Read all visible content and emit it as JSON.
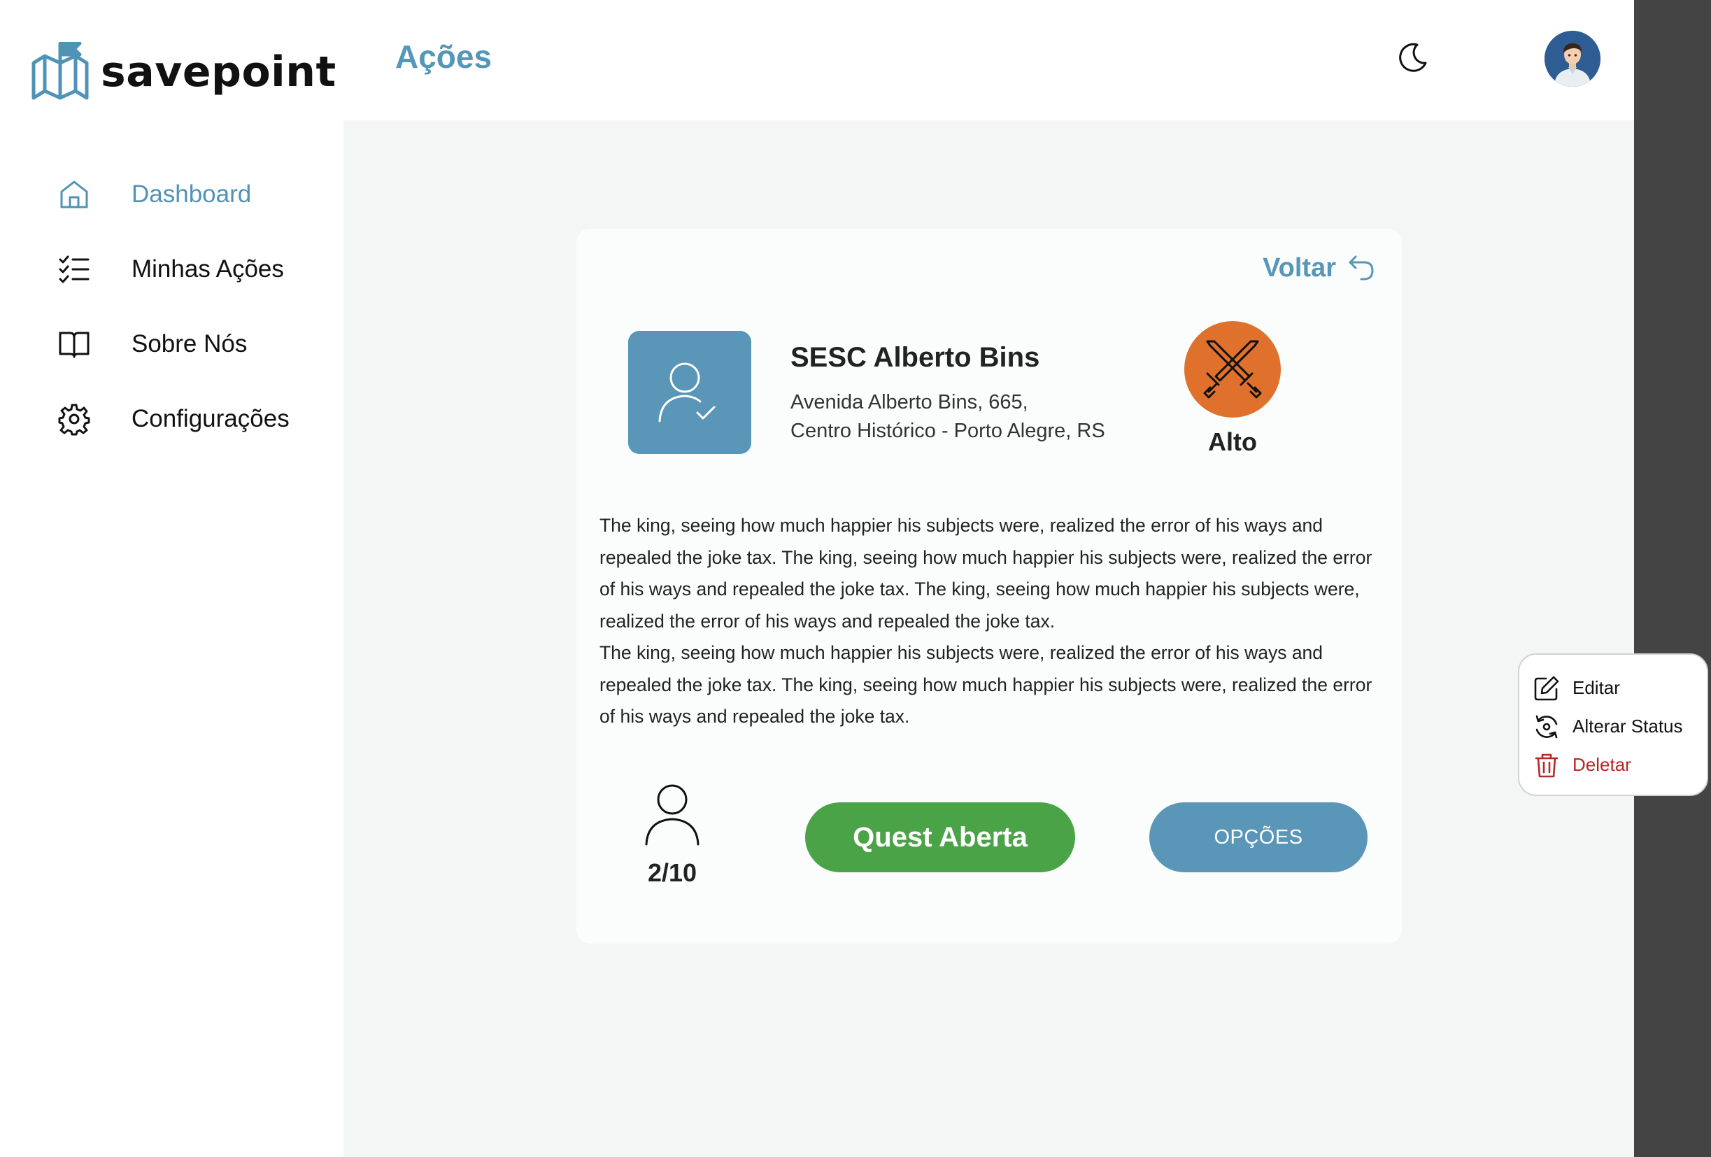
{
  "app": {
    "logo_text": "savepoint",
    "colors": {
      "accent": "#5497b9",
      "success": "#4aa346",
      "level": "#e0712c",
      "danger": "#b52828"
    }
  },
  "sidebar": {
    "items": [
      {
        "label": "Dashboard",
        "icon": "home-icon",
        "active": true
      },
      {
        "label": "Minhas Ações",
        "icon": "checklist-icon"
      },
      {
        "label": "Sobre Nós",
        "icon": "book-icon"
      },
      {
        "label": "Configurações",
        "icon": "gear-icon"
      }
    ]
  },
  "header": {
    "title": "Ações",
    "theme_icon": "moon-icon",
    "avatar_icon": "user-avatar"
  },
  "card": {
    "back_label": "Voltar",
    "org_name": "SESC Alberto Bins",
    "address_line1": "Avenida Alberto Bins, 665,",
    "address_line2": "Centro Histórico - Porto Alegre, RS",
    "level_label": "Alto",
    "description": [
      "The king, seeing how much happier his subjects were, realized the error of his ways and repealed the joke tax. The king, seeing how much happier his subjects were, realized the error of his ways and repealed the joke tax. The king, seeing how much happier his subjects were, realized the error of his ways and repealed the joke tax.",
      "The king, seeing how much happier his subjects were, realized the error of his ways and repealed the joke tax. The king, seeing how much happier his subjects were, realized the error of his ways and repealed the joke tax."
    ],
    "participants": "2/10",
    "status_label": "Quest Aberta",
    "options_label": "OPÇÕES"
  },
  "menu": {
    "items": [
      {
        "label": "Editar",
        "icon": "edit-icon"
      },
      {
        "label": "Alterar Status",
        "icon": "refresh-icon"
      },
      {
        "label": "Deletar",
        "icon": "trash-icon"
      }
    ]
  }
}
